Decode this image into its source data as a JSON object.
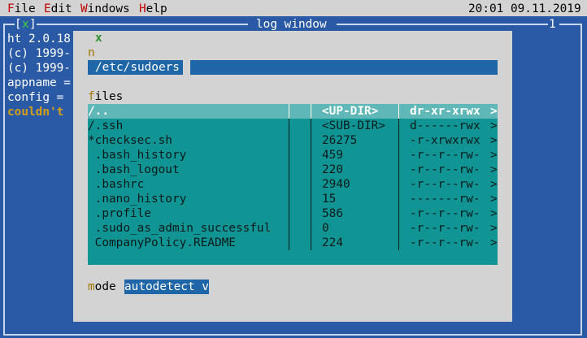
{
  "menubar": {
    "items": [
      {
        "hot": "F",
        "rest": "ile"
      },
      {
        "hot": "E",
        "rest": "dit"
      },
      {
        "hot": "W",
        "rest": "indows"
      },
      {
        "hot": "H",
        "rest": "elp"
      }
    ],
    "clock": "20:01 09.11.2019"
  },
  "log_window": {
    "close_left": "[",
    "close_mark": "x",
    "close_right": "]",
    "title": "log window",
    "number": "1",
    "lines": [
      "ht 2.0.18",
      "(c) 1999-",
      "(c) 1999-",
      "appname =",
      "config =",
      "couldn't"
    ]
  },
  "dialog": {
    "close_mark": "x",
    "name_hot": "n",
    "path_value": "/etc/sudoers",
    "files_label_hot": "f",
    "files_label_rest": "iles",
    "files": [
      {
        "name": "/..",
        "size": "<UP-DIR>",
        "perm": "dr-xr-xrwx",
        "more": ">"
      },
      {
        "name": "/.ssh",
        "size": "<SUB-DIR>",
        "perm": "d------rwx",
        "more": ">"
      },
      {
        "name": "*checksec.sh",
        "size": "26275",
        "perm": "-r-xrwxrwx",
        "more": ">"
      },
      {
        "name": " .bash_history",
        "size": "459",
        "perm": "-r--r--rw-",
        "more": ">"
      },
      {
        "name": " .bash_logout",
        "size": "220",
        "perm": "-r--r--rw-",
        "more": ">"
      },
      {
        "name": " .bashrc",
        "size": "2940",
        "perm": "-r--r--rw-",
        "more": ">"
      },
      {
        "name": " .nano_history",
        "size": "15",
        "perm": "-------rw-",
        "more": ">"
      },
      {
        "name": " .profile",
        "size": "586",
        "perm": "-r--r--rw-",
        "more": ">"
      },
      {
        "name": " .sudo_as_admin_successful",
        "size": "0",
        "perm": "-r--r--rw-",
        "more": ">"
      },
      {
        "name": " CompanyPolicy.README",
        "size": "224",
        "perm": "-r--r--rw-",
        "more": ">"
      }
    ],
    "mode_label_hot": "m",
    "mode_label_rest": "ode",
    "mode_value": "autodetect v"
  },
  "colors": {
    "desktop": "#2a5aa6",
    "menubar": "#d3d3d3",
    "hotkey": "#c00000",
    "dialog_bg": "#d3d3d3",
    "input_bg": "#1f66a8",
    "list_bg": "#109494",
    "list_selected": "#5fb7b7",
    "warning_text": "#d4a017"
  }
}
